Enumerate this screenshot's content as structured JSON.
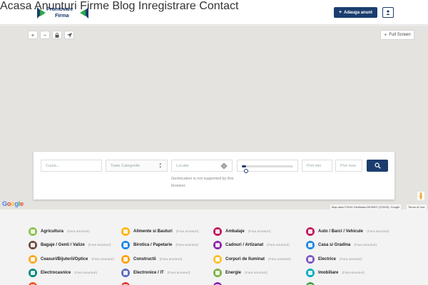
{
  "header": {
    "logo_line1": "Promovare",
    "logo_line2": "Firma",
    "nav": [
      "Acasa",
      "Anunturi",
      "Firme",
      "Blog",
      "Inregistrare",
      "Contact"
    ],
    "add_button_label": "Adauga anunt",
    "brand_color": "#1b3d6e"
  },
  "map": {
    "fullscreen_label": "Full Screen",
    "google_logo": "Google",
    "map_data": "Map data ©2016 GeoBasis-DE/BKG (©2009), Google",
    "terms": "Terms of Use",
    "controls": [
      "plus-icon",
      "minus-icon",
      "lock-icon",
      "send-icon"
    ]
  },
  "search": {
    "query_placeholder": "Cauta...",
    "category_selected": "Toate Categoriile",
    "location_placeholder": "Locatie",
    "geo_message": "Geolocation is not supported by this browser.",
    "price_min_placeholder": "Pret min",
    "price_max_placeholder": "Pret max",
    "slider_value_fraction": 0.08
  },
  "categories": [
    {
      "name": "Agricultura",
      "count": "(Fara anunturi)",
      "color": "#8bc34a"
    },
    {
      "name": "Alimente si Bauturi",
      "count": "(Fara anunturi)",
      "color": "#ffb300"
    },
    {
      "name": "Ambalaje",
      "count": "(Fara anunturi)",
      "color": "#c2185b"
    },
    {
      "name": "Auto / Barci / Vehicule",
      "count": "(Fara anunturi)",
      "color": "#c2185b"
    },
    {
      "name": "Bagaje / Genti / Valize",
      "count": "(Fara anunturi)",
      "color": "#6d4c41"
    },
    {
      "name": "Birotica / Papetarie",
      "count": "(Fara anunturi)",
      "color": "#1e88e5"
    },
    {
      "name": "Cadouri / Artizanat",
      "count": "(Fara anunturi)",
      "color": "#8e24aa"
    },
    {
      "name": "Casa si Gradina",
      "count": "(Fara anunturi)",
      "color": "#1e88e5"
    },
    {
      "name": "Ceasuri/Bijuterii/Optice",
      "count": "(Fara anunturi)",
      "color": "#f9a825"
    },
    {
      "name": "Constructii",
      "count": "(Fara anunturi)",
      "color": "#ffa000"
    },
    {
      "name": "Corpuri de Iluminat",
      "count": "(Fara anunturi)",
      "color": "#fbc02d"
    },
    {
      "name": "Electrice",
      "count": "(Fara anunturi)",
      "color": "#7e57c2"
    },
    {
      "name": "Electrocasnice",
      "count": "(Fara anunturi)",
      "color": "#00897b"
    },
    {
      "name": "Electronice / IT",
      "count": "(Fara anunturi)",
      "color": "#5c6bc0"
    },
    {
      "name": "Energie",
      "count": "(Fara anunturi)",
      "color": "#7cb342"
    },
    {
      "name": "Imobiliare",
      "count": "(Fara anunturi)",
      "color": "#00acc1"
    },
    {
      "name": "",
      "count": "",
      "color": "#f4511e"
    },
    {
      "name": "",
      "count": "",
      "color": "#e53935"
    },
    {
      "name": "",
      "count": "",
      "color": "#8e24aa"
    },
    {
      "name": "",
      "count": "",
      "color": "#43a047"
    }
  ]
}
